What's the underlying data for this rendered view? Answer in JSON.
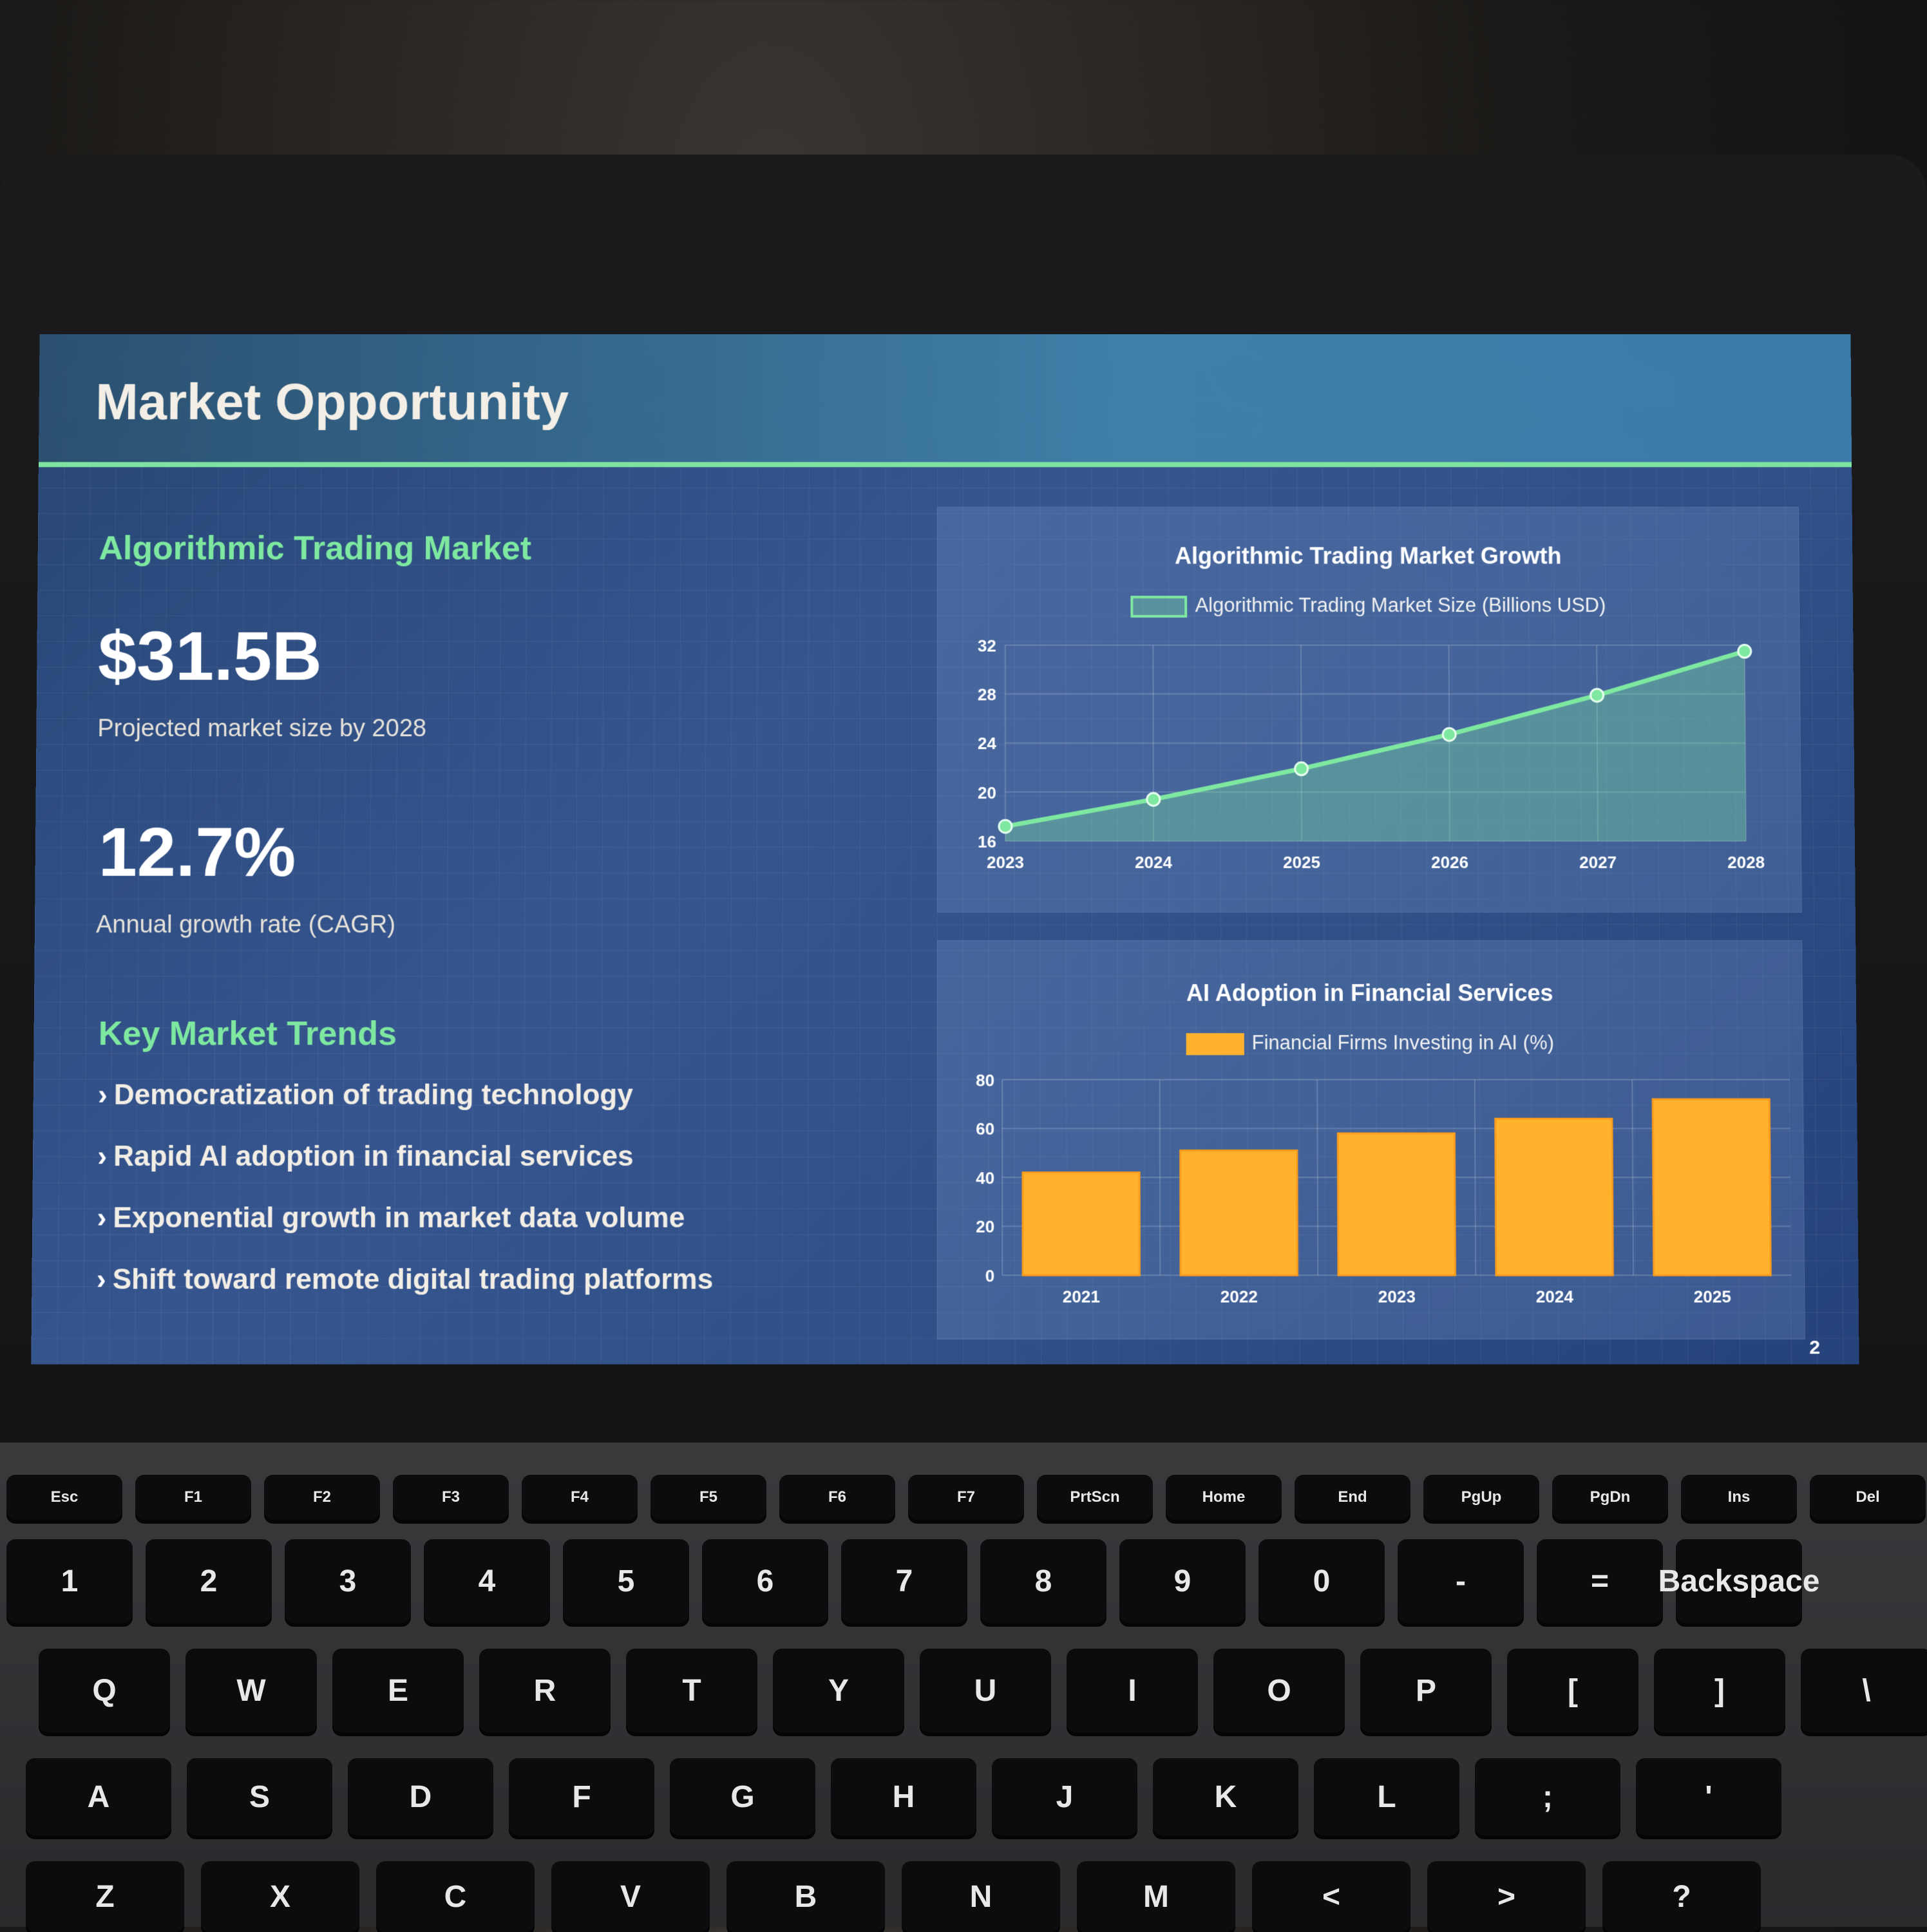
{
  "slide": {
    "title": "Market Opportunity",
    "section1_heading": "Algorithmic Trading Market",
    "stat1_value": "$31.5B",
    "stat1_caption": "Projected market size by 2028",
    "stat2_value": "12.7%",
    "stat2_caption": "Annual growth rate (CAGR)",
    "trends_heading": "Key Market Trends",
    "trends": [
      "Democratization of trading technology",
      "Rapid AI adoption in financial services",
      "Exponential growth in market data volume",
      "Shift toward remote digital trading platforms"
    ],
    "page_number": "2"
  },
  "colors": {
    "accent_green": "#7ee8a0",
    "bar_orange": "#ffb22e",
    "background_blue": "#2f4f86"
  },
  "icons": {
    "trend_bullet": "chevron-right-icon"
  },
  "chart_data": [
    {
      "type": "line",
      "title": "Algorithmic Trading Market Growth",
      "x": [
        "2023",
        "2024",
        "2025",
        "2026",
        "2027",
        "2028"
      ],
      "series": [
        {
          "name": "Algorithmic Trading Market Size (Billions USD)",
          "values": [
            17.2,
            19.4,
            21.9,
            24.7,
            27.9,
            31.5
          ]
        }
      ],
      "ylim": [
        16,
        32
      ],
      "yticks": [
        "16",
        "20",
        "24",
        "28",
        "32"
      ],
      "grid": true,
      "legend": "top-center",
      "fill": "area"
    },
    {
      "type": "bar",
      "title": "AI Adoption in Financial Services",
      "categories": [
        "2021",
        "2022",
        "2023",
        "2024",
        "2025"
      ],
      "series": [
        {
          "name": "Financial Firms Investing in AI (%)",
          "values": [
            42,
            51,
            58,
            64,
            72
          ]
        }
      ],
      "ylim": [
        0,
        80
      ],
      "yticks": [
        "0",
        "20",
        "40",
        "60",
        "80"
      ],
      "grid": true,
      "legend": "top-center"
    }
  ],
  "keyboard": {
    "fn_row": [
      "Esc",
      "F1",
      "F2",
      "F3",
      "F4",
      "F5",
      "F6",
      "F7",
      "PrtScn",
      "Home",
      "End",
      "PgUp",
      "PgDn",
      "Ins",
      "Del"
    ],
    "number_row": [
      "1",
      "2",
      "3",
      "4",
      "5",
      "6",
      "7",
      "8",
      "9",
      "0",
      "-",
      "=",
      "Backspace"
    ],
    "row_q": [
      "Q",
      "W",
      "E",
      "R",
      "T",
      "Y",
      "U",
      "I",
      "O",
      "P",
      "[",
      "]",
      "\\"
    ],
    "row_a": [
      "A",
      "S",
      "D",
      "F",
      "G",
      "H",
      "J",
      "K",
      "L",
      ";",
      "'"
    ],
    "row_z": [
      "Z",
      "X",
      "C",
      "V",
      "B",
      "N",
      "M",
      "<",
      ">",
      "?"
    ]
  }
}
